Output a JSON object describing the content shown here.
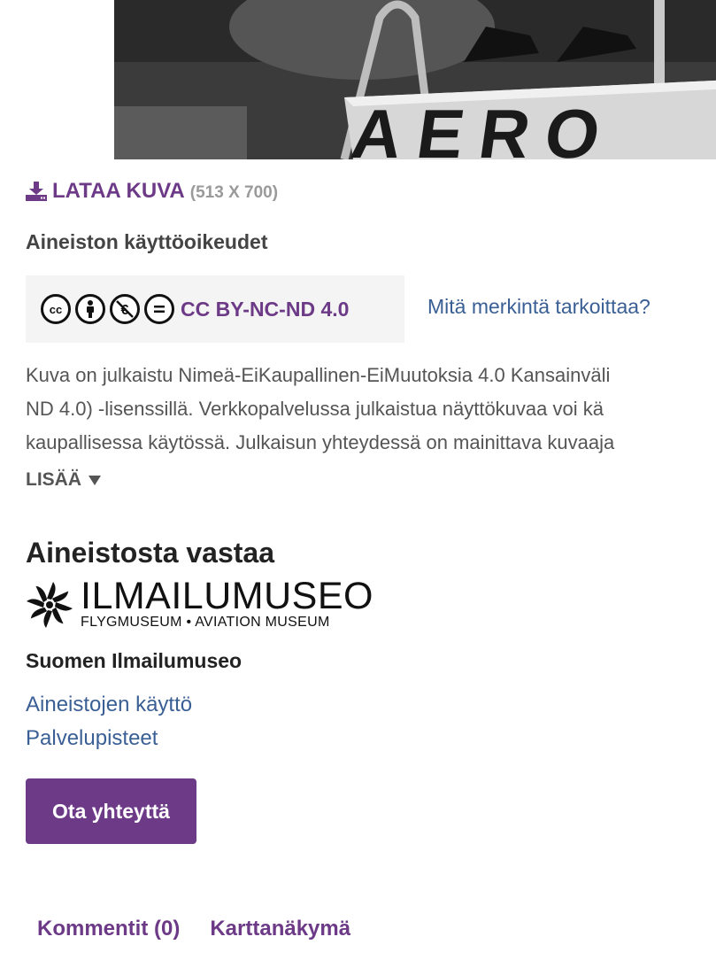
{
  "photo": {
    "alt_label": "AERO"
  },
  "download": {
    "label": "LATAA KUVA",
    "dimensions": "(513 X 700)",
    "icon": "download-icon"
  },
  "rights": {
    "heading": "Aineiston käyttöoikeudet",
    "license_name": "CC BY-NC-ND 4.0",
    "license_icons": [
      "cc-icon",
      "by-icon",
      "nc-icon",
      "nd-icon"
    ],
    "help_link": "Mitä merkintä tarkoittaa?",
    "text_lines": [
      "Kuva on julkaistu Nimeä-EiKaupallinen-EiMuutoksia 4.0 Kansainväli",
      "ND 4.0) -lisenssillä. Verkkopalvelussa julkaistua näyttökuvaa voi kä",
      "kaupallisessa käytössä. Julkaisun yhteydessä on mainittava kuvaaja"
    ],
    "more_label": "LISÄÄ"
  },
  "responsible": {
    "heading": "Aineistosta vastaa",
    "logo_main": "ILMAILUMUSEO",
    "logo_sub": "FLYGMUSEUM • AVIATION MUSEUM",
    "org_name": "Suomen Ilmailumuseo",
    "links": [
      "Aineistojen käyttö",
      "Palvelupisteet"
    ],
    "contact_button": "Ota yhteyttä"
  },
  "tabs": [
    "Kommentit (0)",
    "Karttanäkymä"
  ],
  "colors": {
    "accent": "#6c3a86",
    "link": "#3a5f95",
    "license_bg": "#f4f4f4"
  }
}
